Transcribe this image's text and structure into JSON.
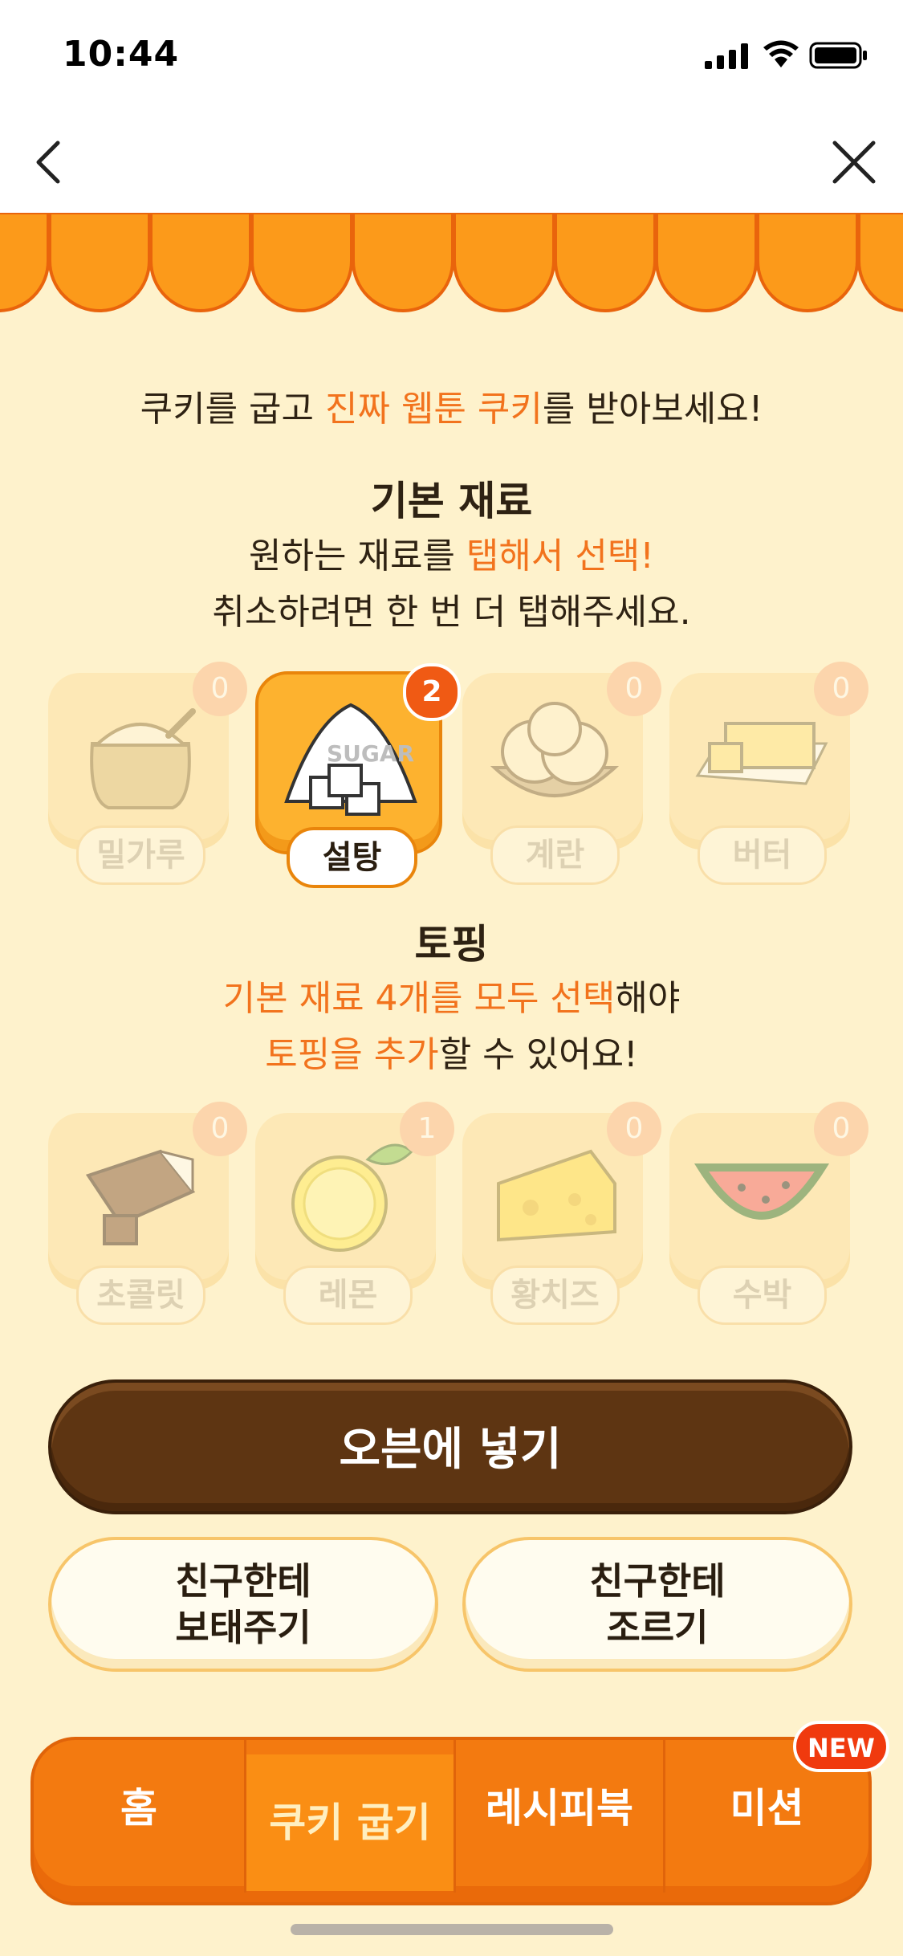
{
  "status_bar": {
    "time": "10:44"
  },
  "header": {
    "back_icon": "chevron-left-icon",
    "close_icon": "close-icon"
  },
  "intro": {
    "part1": "쿠키를 굽고 ",
    "highlight": "진짜 웹툰 쿠키",
    "part2": "를 받아보세요!"
  },
  "base_section": {
    "title": "기본 재료",
    "line1_a": "원하는 재료를 ",
    "line1_highlight": "탭해서 선택!",
    "line2": "취소하려면 한 번 더 탭해주세요.",
    "items": [
      {
        "label": "밀가루",
        "count": "0",
        "icon": "flour-sack-icon",
        "selected": false
      },
      {
        "label": "설탕",
        "count": "2",
        "icon": "sugar-icon",
        "selected": true
      },
      {
        "label": "계란",
        "count": "0",
        "icon": "eggs-icon",
        "selected": false
      },
      {
        "label": "버터",
        "count": "0",
        "icon": "butter-icon",
        "selected": false
      }
    ]
  },
  "topping_section": {
    "title": "토핑",
    "line1_highlight": "기본 재료 4개를 모두 선택",
    "line1_b": "해야",
    "line2_highlight": "토핑을 추가",
    "line2_b": "할 수 있어요!",
    "items": [
      {
        "label": "초콜릿",
        "count": "0",
        "icon": "chocolate-icon"
      },
      {
        "label": "레몬",
        "count": "1",
        "icon": "lemon-icon"
      },
      {
        "label": "황치즈",
        "count": "0",
        "icon": "cheese-icon"
      },
      {
        "label": "수박",
        "count": "0",
        "icon": "watermelon-icon"
      }
    ]
  },
  "actions": {
    "oven": "오븐에 넣기",
    "give_line1": "친구한테",
    "give_line2": "보태주기",
    "ask_line1": "친구한테",
    "ask_line2": "조르기"
  },
  "tabbar": {
    "tabs": [
      {
        "label": "홈",
        "active": false
      },
      {
        "label": "쿠키 굽기",
        "active": true
      },
      {
        "label": "레시피북",
        "active": false
      },
      {
        "label": "미션",
        "active": false
      }
    ],
    "new_badge": "NEW"
  },
  "colors": {
    "accent": "#F2731D",
    "background": "#FEF2CC",
    "oven_button": "#5E3512",
    "tabbar": "#F37A10"
  }
}
